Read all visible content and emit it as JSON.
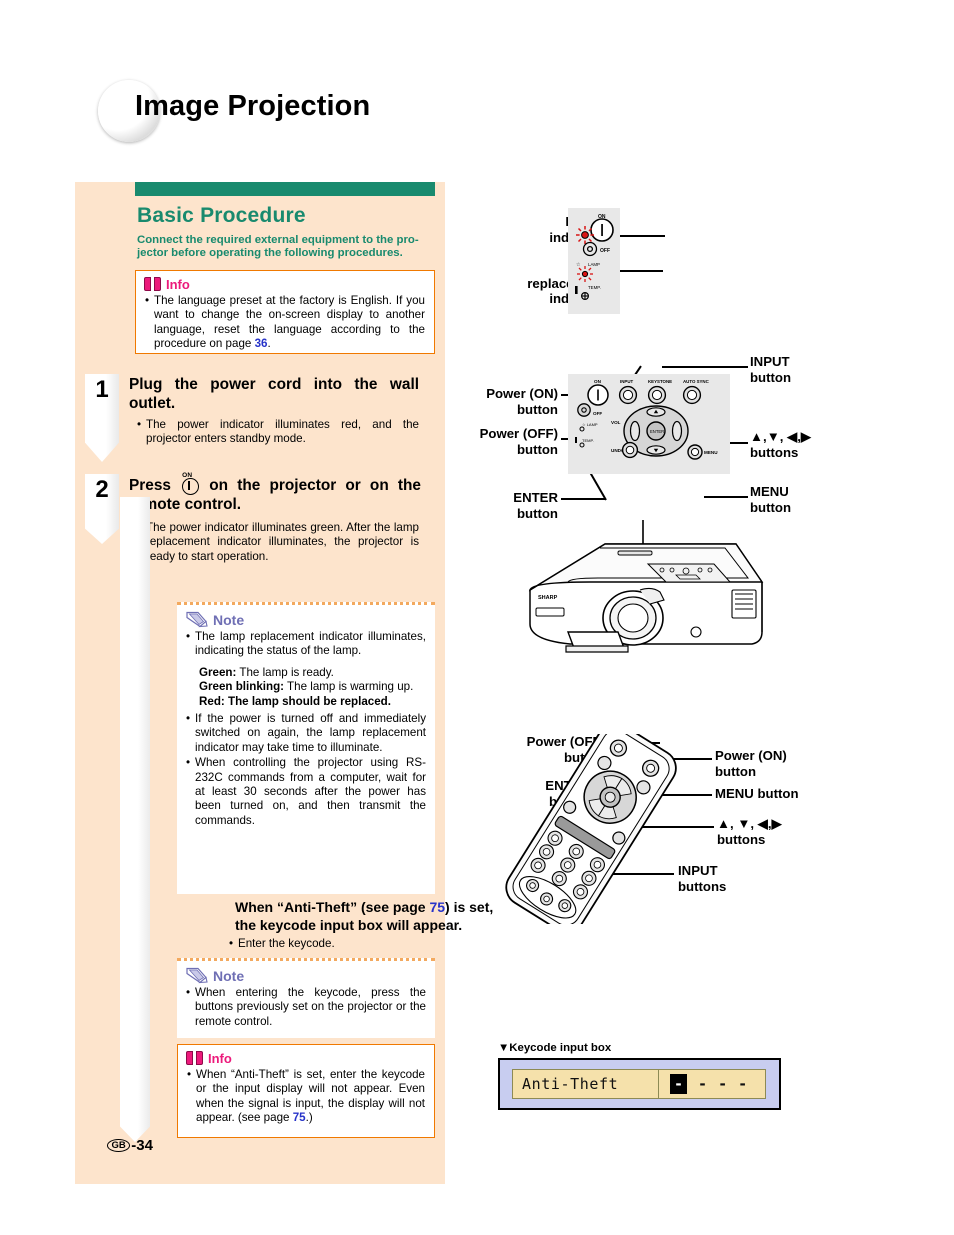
{
  "page": {
    "title": "Image Projection",
    "footer_region": "GB",
    "footer_page": "-34"
  },
  "section": {
    "heading": "Basic Procedure",
    "subheading": "Connect the required external equipment to the pro-jector before operating the following procedures."
  },
  "info_top": {
    "icon": "book-icon",
    "label": "Info",
    "bullets": [
      {
        "pre": "The language preset at the factory is English. If you want to change the on-screen display to another language, reset the language according to the procedure on page ",
        "page_ref": "36",
        "post": "."
      }
    ]
  },
  "steps": [
    {
      "number": "1",
      "heading": "Plug the power cord into the wall outlet.",
      "bullets": [
        "The power indicator illuminates red, and the projector enters standby mode."
      ]
    },
    {
      "number": "2",
      "heading_pre": "Press",
      "heading_icon": "power-on-icon",
      "heading_icon_label": "ON",
      "heading_post": "on the projector or on the remote control.",
      "bullets": [
        "The power indicator illuminates green. After the lamp replacement indicator illuminates, the projector is ready to start operation."
      ]
    }
  ],
  "note_one": {
    "icon": "pencil-icon",
    "label": "Note",
    "bullets": [
      "The lamp replacement indicator illuminates, indicating the status of the lamp."
    ],
    "statuses": [
      {
        "label": "Green:",
        "text": "The lamp is ready."
      },
      {
        "label": "Green blinking:",
        "text": "The lamp is warming up."
      },
      {
        "label": "Red: The lamp should be replaced.",
        "text": ""
      }
    ],
    "bullets_after": [
      "If the power is turned off and immediately switched on again, the lamp replacement indicator may take time to illuminate.",
      "When controlling the projector using RS-232C commands from a computer, wait for at least 30 seconds after the power has been turned on, and then transmit the commands."
    ]
  },
  "anti_theft_block": {
    "heading_pre": "When “Anti-Theft” (see page ",
    "heading_page_ref": "75",
    "heading_post": ") is set, the keycode input box will appear.",
    "bullets": [
      "Enter the keycode."
    ]
  },
  "note_two": {
    "icon": "pencil-icon",
    "label": "Note",
    "bullets": [
      "When entering the keycode, press the buttons previously set on the projector or the remote control."
    ]
  },
  "info_bottom": {
    "icon": "book-icon",
    "label": "Info",
    "bullets": [
      {
        "pre": "When “Anti-Theft” is set, enter the keycode or the input display will not appear. Even when the signal is input, the display will not appear. (see page ",
        "page_ref": "75",
        "post": ".)"
      }
    ]
  },
  "indicator_diagram": {
    "labels": [
      {
        "id": "power-indicator",
        "text": "Power\nindicator"
      },
      {
        "id": "lamp-replacement-indicator",
        "text": "Lamp\nreplacement\nindicator"
      }
    ],
    "panel_marks": {
      "on": "ON",
      "off": "OFF",
      "lamp": "LAMP",
      "temp": "TEMP."
    }
  },
  "control_panel_diagram": {
    "labels": [
      {
        "id": "power-on-button",
        "text": "Power (ON)\nbutton"
      },
      {
        "id": "power-off-button",
        "text": "Power (OFF)\nbutton"
      },
      {
        "id": "enter-button",
        "text": "ENTER\nbutton"
      },
      {
        "id": "input-button",
        "text": "INPUT\nbutton"
      },
      {
        "id": "arrow-buttons",
        "text": "▲,▼, ◀,▶\nbuttons"
      },
      {
        "id": "menu-button",
        "text": "MENU\nbutton"
      }
    ],
    "panel_marks": [
      "ON",
      "OFF",
      "INPUT",
      "KEYSTONE",
      "AUTO SYNC",
      "VOL",
      "UNDO",
      "MENU",
      "LAMP",
      "TEMP."
    ]
  },
  "remote_diagram": {
    "labels": [
      {
        "id": "remote-power-off-button",
        "text": "Power (OFF)\nbutton"
      },
      {
        "id": "remote-enter-button",
        "text": "ENTER\nbutton"
      },
      {
        "id": "remote-power-on-button",
        "text": "Power (ON)\nbutton"
      },
      {
        "id": "remote-menu-button",
        "text": "MENU button"
      },
      {
        "id": "remote-arrow-buttons",
        "text": "▲, ▼, ◀,▶\nbuttons"
      },
      {
        "id": "remote-input-buttons",
        "text": "INPUT\nbuttons"
      }
    ]
  },
  "keycode_box": {
    "caption": "▼Keycode input box",
    "field_label": "Anti-Theft",
    "slots": [
      "-",
      "-",
      "-",
      "-"
    ],
    "active_slot_index": 0
  },
  "colors": {
    "peach": "#fde4cc",
    "teal": "#198a6e",
    "orange_border": "#f07900",
    "magenta": "#ec1a7b",
    "note_purple": "#6f6fb4",
    "page_ref_blue": "#2733c9",
    "keycode_bg": "#c8cdf0",
    "keycode_field": "#f5e1ab"
  }
}
